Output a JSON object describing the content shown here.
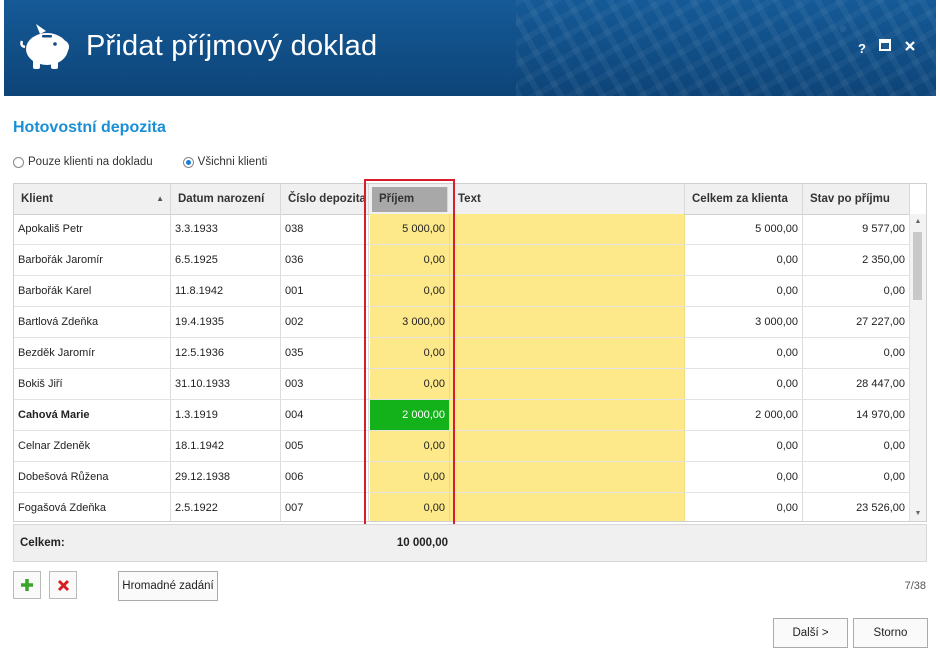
{
  "window": {
    "title": "Přidat příjmový doklad",
    "help": "?",
    "maximize": "□",
    "close": "✕"
  },
  "section": {
    "title": "Hotovostní depozita"
  },
  "filter": {
    "option1": "Pouze klienti na dokladu",
    "option2": "Všichni klienti",
    "selected": "Všichni klienti"
  },
  "table": {
    "headers": [
      "Klient",
      "Datum narození",
      "Číslo depozita",
      "Příjem",
      "Text",
      "Celkem za klienta",
      "Stav po příjmu"
    ],
    "rows": [
      {
        "klient": "Apokališ Petr",
        "datum": "3.3.1933",
        "cislo": "038",
        "prijem": "5 000,00",
        "text": "",
        "celkem": "5 000,00",
        "stav": "9 577,00"
      },
      {
        "klient": "Barbořák Jaromír",
        "datum": "6.5.1925",
        "cislo": "036",
        "prijem": "0,00",
        "text": "",
        "celkem": "0,00",
        "stav": "2 350,00"
      },
      {
        "klient": "Barbořák Karel",
        "datum": "11.8.1942",
        "cislo": "001",
        "prijem": "0,00",
        "text": "",
        "celkem": "0,00",
        "stav": "0,00"
      },
      {
        "klient": "Bartlová Zdeňka",
        "datum": "19.4.1935",
        "cislo": "002",
        "prijem": "3 000,00",
        "text": "",
        "celkem": "3 000,00",
        "stav": "27 227,00"
      },
      {
        "klient": "Bezděk Jaromír",
        "datum": "12.5.1936",
        "cislo": "035",
        "prijem": "0,00",
        "text": "",
        "celkem": "0,00",
        "stav": "0,00"
      },
      {
        "klient": "Bokiš Jiří",
        "datum": "31.10.1933",
        "cislo": "003",
        "prijem": "0,00",
        "text": "",
        "celkem": "0,00",
        "stav": "28 447,00"
      },
      {
        "klient": "Cahová Marie",
        "datum": "1.3.1919",
        "cislo": "004",
        "prijem": "2 000,00",
        "text": "",
        "celkem": "2 000,00",
        "stav": "14 970,00"
      },
      {
        "klient": "Celnar Zdeněk",
        "datum": "18.1.1942",
        "cislo": "005",
        "prijem": "0,00",
        "text": "",
        "celkem": "0,00",
        "stav": "0,00"
      },
      {
        "klient": "Dobešová Růžena",
        "datum": "29.12.1938",
        "cislo": "006",
        "prijem": "0,00",
        "text": "",
        "celkem": "0,00",
        "stav": "0,00"
      },
      {
        "klient": "Fogašová Zdeňka",
        "datum": "2.5.1922",
        "cislo": "007",
        "prijem": "0,00",
        "text": "",
        "celkem": "0,00",
        "stav": "23 526,00"
      }
    ],
    "selected_row": 6
  },
  "footer": {
    "label": "Celkem:",
    "total": "10 000,00"
  },
  "buttons": {
    "bulk": "Hromadné zadání",
    "next": "Další >",
    "cancel": "Storno"
  },
  "pager": "7/38",
  "colors": {
    "titlebar": "#0f4c84",
    "accent": "#1a8fd6",
    "yellow": "#fde98a",
    "green": "#13b21a",
    "highlight": "#d61f2b"
  }
}
